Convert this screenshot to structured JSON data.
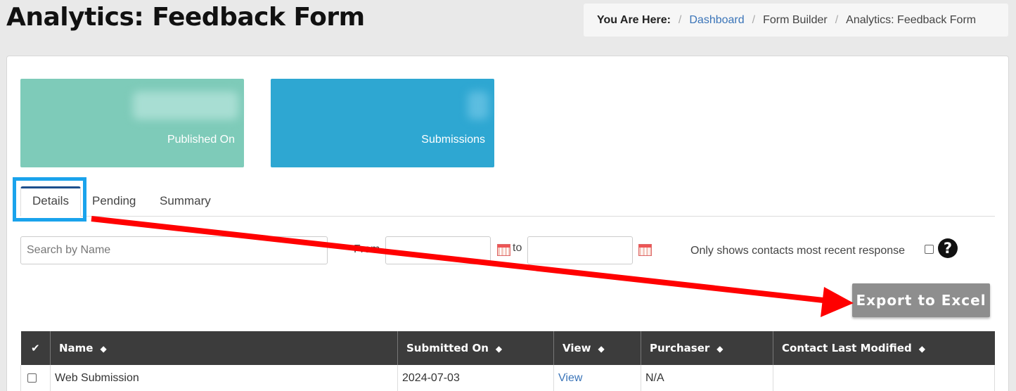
{
  "page": {
    "title": "Analytics: Feedback Form"
  },
  "breadcrumb": {
    "lead": "You Are Here:",
    "items": [
      "Dashboard",
      "Form Builder",
      "Analytics: Feedback Form"
    ]
  },
  "stats": [
    {
      "caption": "Published On"
    },
    {
      "caption": "Submissions"
    }
  ],
  "tabs": [
    "Details",
    "Pending",
    "Summary"
  ],
  "filters": {
    "search_placeholder": "Search by Name",
    "from_label": "From",
    "to_label": "to",
    "recent_label": "Only shows contacts most recent response",
    "help_glyph": "?"
  },
  "export_label": "Export to Excel",
  "table": {
    "select_glyph": "✔",
    "sort_glyph": "◆",
    "columns": [
      "Name",
      "Submitted On",
      "View",
      "Purchaser",
      "Contact Last Modified"
    ],
    "rows": [
      {
        "name": "Web Submission",
        "submitted_on": "2024-07-03",
        "view": "View",
        "purchaser": "N/A",
        "contact_last_modified": ""
      }
    ]
  },
  "colors": {
    "tile_green": "#7ecbb9",
    "tile_blue": "#2ea7d2",
    "tab_highlight": "#1aa3ec",
    "annotation_arrow": "#ff0000",
    "export_button": "#8e8e8e",
    "table_header": "#3c3c3c",
    "link": "#3a74b8"
  }
}
